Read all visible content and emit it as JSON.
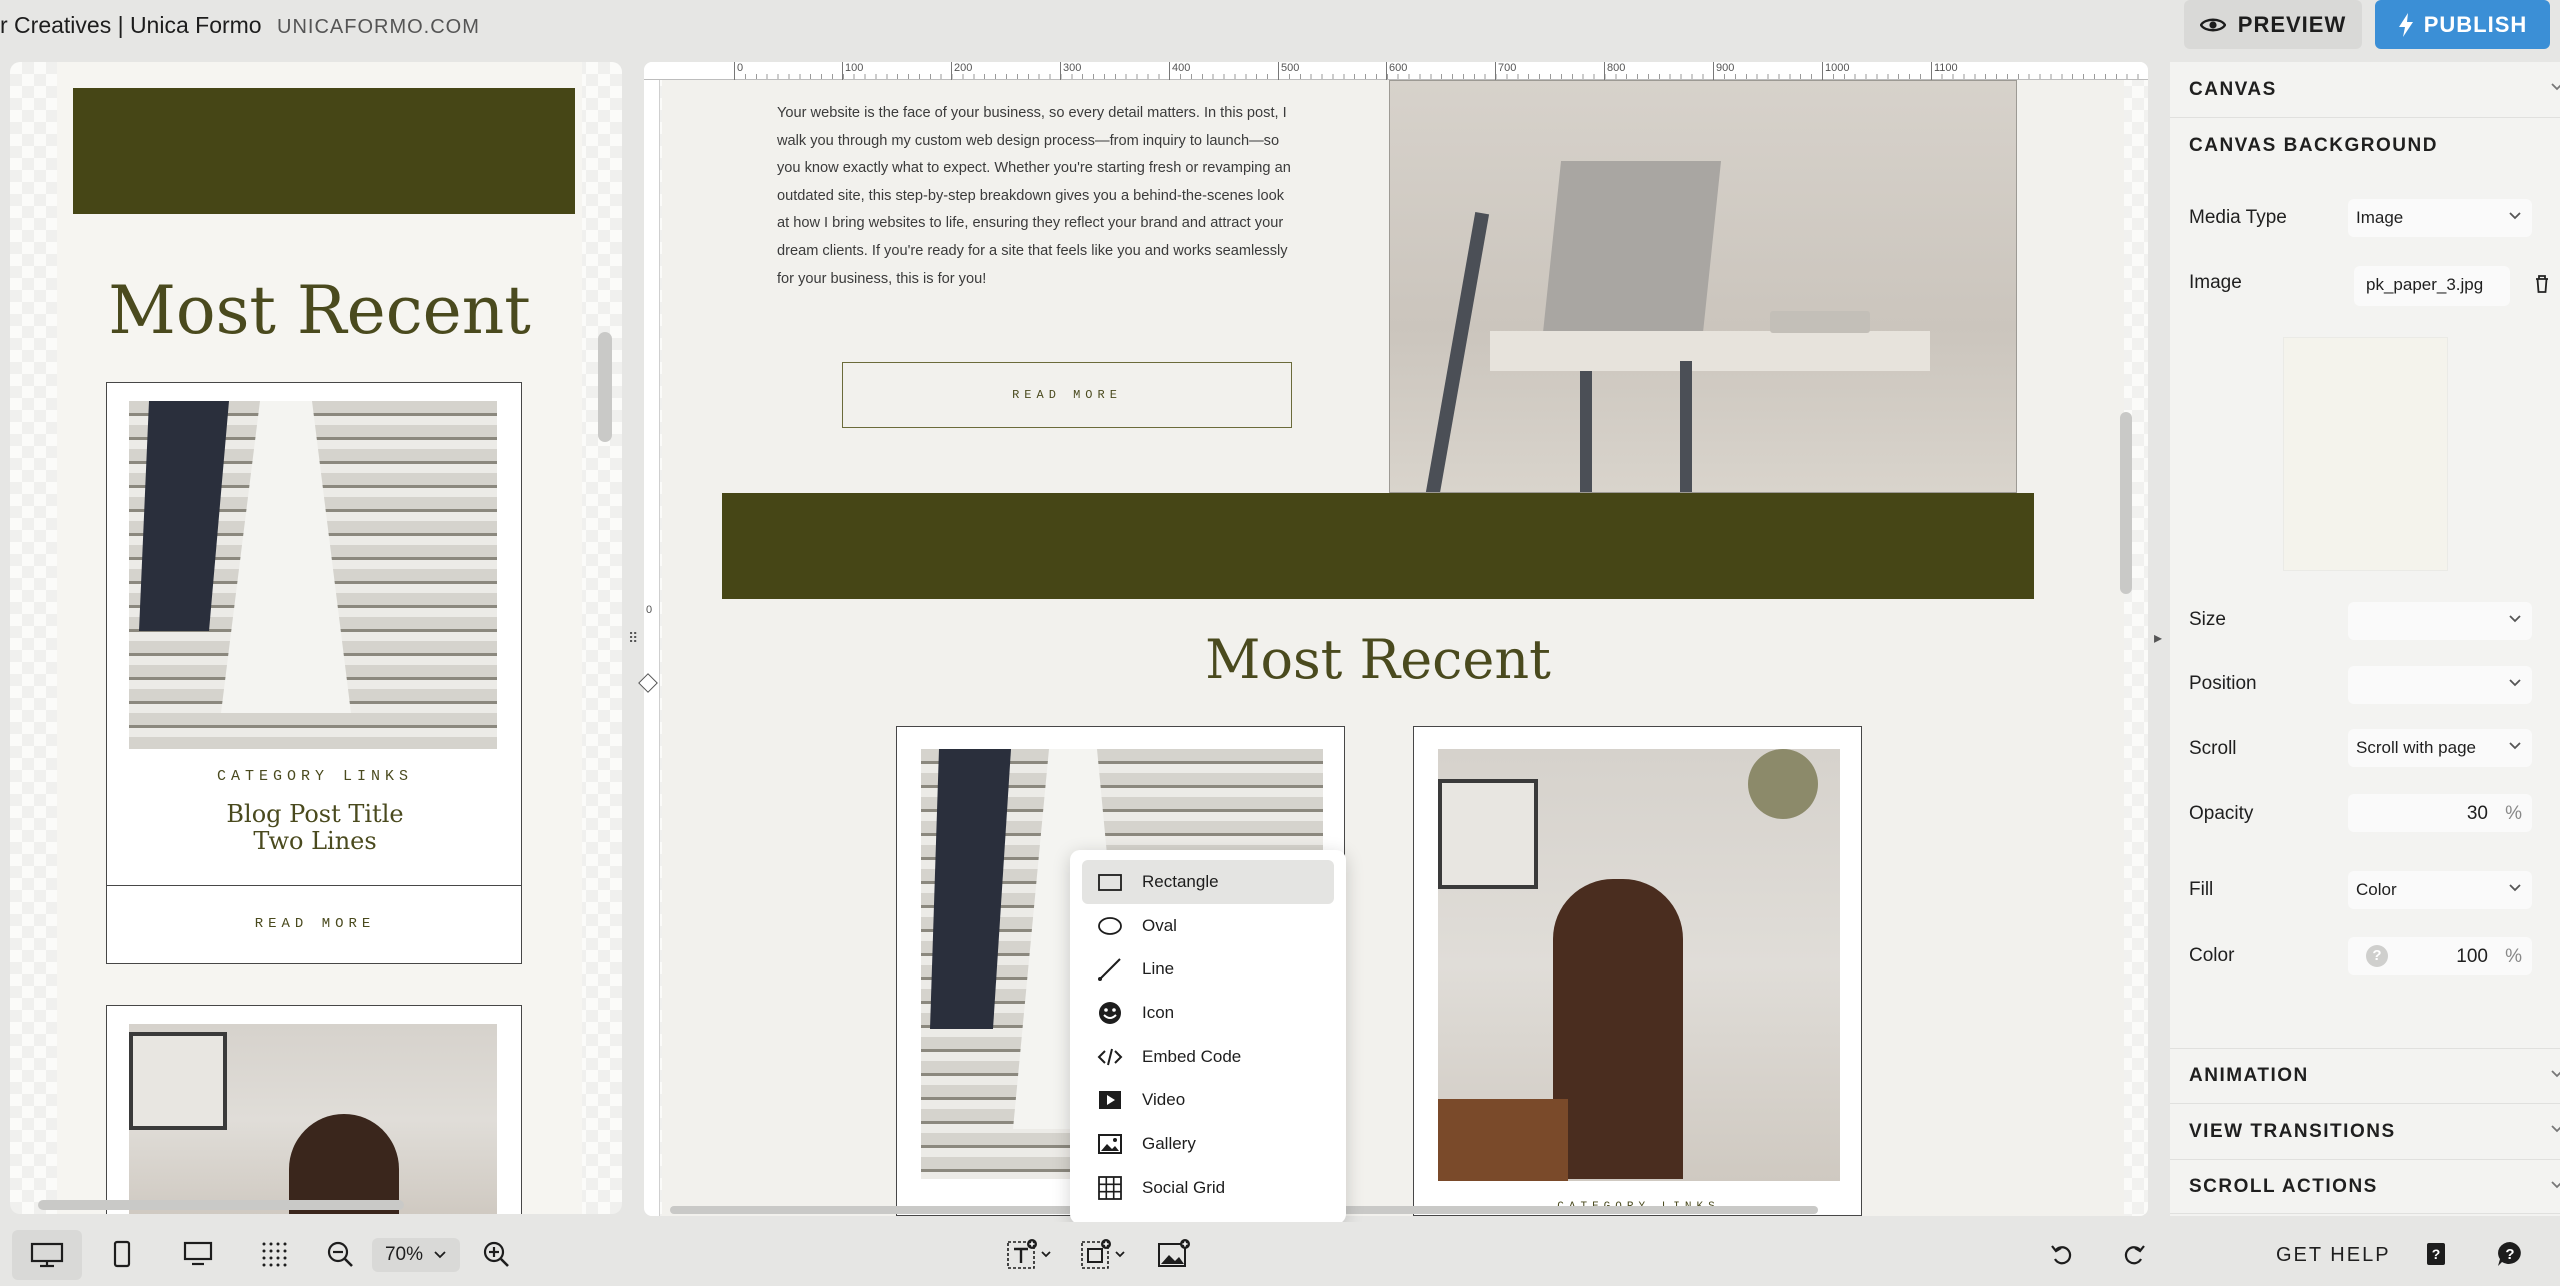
{
  "header": {
    "site_title": "r Creatives | Unica Formo",
    "site_domain": "UNICAFORMO.COM",
    "preview_label": "PREVIEW",
    "publish_label": "PUBLISH"
  },
  "mobile_preview": {
    "heading": "Most Recent",
    "card1": {
      "category": "CATEGORY LINKS",
      "title_line1": "Blog Post Title",
      "title_line2": "Two Lines",
      "read_more": "READ MORE"
    }
  },
  "canvas": {
    "ruler_labels": [
      "0",
      "100",
      "200",
      "300",
      "400",
      "500",
      "600",
      "700",
      "800",
      "900",
      "1000",
      "1100"
    ],
    "ruler_left_label": "0",
    "body_text": [
      "Your website is the face of your business, so every detail matters. In this post, I",
      "walk you through my custom web design process—from inquiry to launch—so",
      "you know exactly what to expect. Whether you're starting fresh or revamping an",
      "outdated site, this step-by-step breakdown gives you a behind-the-scenes look",
      "at how I bring websites to life, ensuring they reflect your brand and attract your",
      "dream clients. If you're ready for a site that feels like you and works seamlessly",
      "for your business, this is for you!"
    ],
    "read_more": "READ MORE",
    "heading": "Most Recent",
    "card_bottom_label": "CATEGORY LINKS"
  },
  "add_menu": {
    "items": [
      {
        "label": "Rectangle",
        "icon": "rectangle-icon",
        "active": true
      },
      {
        "label": "Oval",
        "icon": "oval-icon"
      },
      {
        "label": "Line",
        "icon": "line-icon"
      },
      {
        "label": "Icon",
        "icon": "smiley-icon"
      },
      {
        "label": "Embed Code",
        "icon": "code-icon"
      },
      {
        "label": "Video",
        "icon": "video-icon"
      },
      {
        "label": "Gallery",
        "icon": "gallery-icon"
      },
      {
        "label": "Social Grid",
        "icon": "grid-icon"
      }
    ]
  },
  "properties": {
    "canvas_section": "CANVAS",
    "canvas_bg_section": "CANVAS BACKGROUND",
    "media_type_label": "Media Type",
    "media_type_value": "Image",
    "image_label": "Image",
    "image_file": "pk_paper_3.jpg",
    "size_label": "Size",
    "size_value": "",
    "position_label": "Position",
    "position_value": "",
    "scroll_label": "Scroll",
    "scroll_value": "Scroll with page",
    "opacity_label": "Opacity",
    "opacity_value": "30",
    "percent": "%",
    "fill_label": "Fill",
    "fill_value": "Color",
    "color_label": "Color",
    "color_value": "100",
    "animation_section": "ANIMATION",
    "view_transitions_section": "VIEW TRANSITIONS",
    "scroll_actions_section": "SCROLL ACTIONS",
    "image_swatch_color": "#f4f3ec"
  },
  "bottom_toolbar": {
    "zoom_value": "70%",
    "get_help": "GET HELP"
  },
  "colors": {
    "olive": "#464616",
    "accent_blue": "#3b8fd6",
    "heading_olive": "#4a4a1e"
  }
}
